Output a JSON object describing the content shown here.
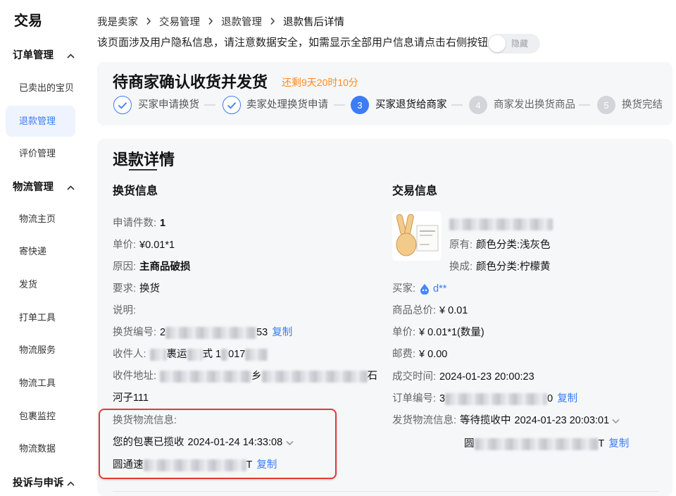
{
  "app": {
    "title": "交易"
  },
  "sidebar": {
    "sections": [
      {
        "label": "订单管理",
        "items": [
          {
            "label": "已卖出的宝贝"
          },
          {
            "label": "退款管理",
            "active": true
          },
          {
            "label": "评价管理"
          }
        ]
      },
      {
        "label": "物流管理",
        "items": [
          {
            "label": "物流主页"
          },
          {
            "label": "寄快递"
          },
          {
            "label": "发货"
          },
          {
            "label": "打单工具"
          },
          {
            "label": "物流服务"
          },
          {
            "label": "物流工具"
          },
          {
            "label": "包裹监控"
          },
          {
            "label": "物流数据"
          }
        ]
      },
      {
        "label": "投诉与申诉",
        "items": []
      }
    ]
  },
  "breadcrumb": [
    {
      "label": "我是卖家"
    },
    {
      "label": "交易管理"
    },
    {
      "label": "退款管理"
    },
    {
      "label": "退款售后详情",
      "current": true
    }
  ],
  "privacy": {
    "notice": "该页面涉及用户隐私信息，请注意数据安全，如需显示全部用户信息请点击右侧按钮",
    "toggle_label": "隐藏",
    "toggle_on": false
  },
  "status": {
    "title": "待商家确认收货并发货",
    "countdown": "还剩9天20时10分",
    "steps": [
      {
        "label": "买家申请换货",
        "state": "done"
      },
      {
        "label": "卖家处理换货申请",
        "state": "done"
      },
      {
        "number": "3",
        "label": "买家退货给商家",
        "state": "current"
      },
      {
        "number": "4",
        "label": "商家发出换货商品",
        "state": "todo"
      },
      {
        "number": "5",
        "label": "换货完结",
        "state": "todo"
      }
    ]
  },
  "detail": {
    "title": "退款详情",
    "exchange": {
      "heading": "换货信息",
      "quantity": {
        "label": "申请件数:",
        "value": "1"
      },
      "unit_price": {
        "label": "单价:",
        "value": "¥0.01*1"
      },
      "reason": {
        "label": "原因:",
        "value": "主商品破损"
      },
      "request": {
        "label": "要求:",
        "value": "换货"
      },
      "note": {
        "label": "说明:"
      },
      "exchange_no": {
        "label": "换货编号:",
        "visible_start": "2",
        "visible_end": "53",
        "copy_label": "复制"
      },
      "receiver": {
        "label": "收件人:",
        "visible_parts": [
          "裹运",
          "式 1",
          "017"
        ]
      },
      "address": {
        "label": "收件地址:",
        "visible_parts": [
          "乡",
          "石"
        ],
        "line2": "河子111"
      },
      "logistics": {
        "label": "换货物流信息:",
        "status": "您的包裹已揽收",
        "time": "2024-01-24 14:33:08",
        "carrier_start": "圆通速",
        "tracking_end": "T",
        "copy_label": "复制"
      }
    },
    "trade": {
      "heading": "交易信息",
      "original": {
        "label": "原有:",
        "value": "颜色分类:浅灰色"
      },
      "exchanged": {
        "label": "换成:",
        "value": "颜色分类:柠檬黄"
      },
      "buyer": {
        "label": "买家:",
        "name": "d**"
      },
      "total": {
        "label": "商品总价:",
        "value": "¥ 0.01"
      },
      "unit_price": {
        "label": "单价:",
        "value": "¥ 0.01*1(数量)"
      },
      "shipping_fee": {
        "label": "邮费:",
        "value": "¥ 0.00"
      },
      "deal_time": {
        "label": "成交时间:",
        "value": "2024-01-23 20:00:23"
      },
      "order_no": {
        "label": "订单编号:",
        "visible_start": "3",
        "visible_end": "0",
        "copy_label": "复制"
      },
      "delivery": {
        "label": "发货物流信息:",
        "status": "等待揽收中",
        "time": "2024-01-23 20:03:01",
        "carrier_start": "圆",
        "tracking_end": "T",
        "copy_label": "复制"
      }
    }
  },
  "colors": {
    "accent": "#3c7cf6",
    "countdown": "#ff8a1f",
    "highlight_border": "#e53935",
    "card_bg": "#f6f7f9"
  }
}
